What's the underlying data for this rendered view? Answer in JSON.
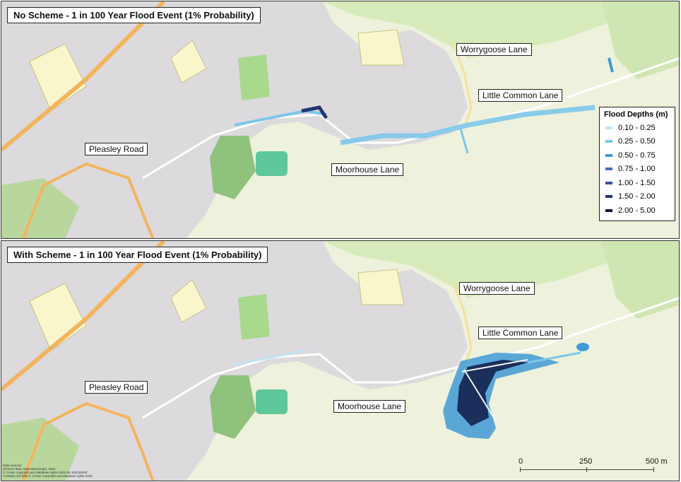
{
  "panels": [
    {
      "title": "No Scheme - 1 in 100 Year Flood Event (1% Probability)",
      "labels": {
        "worrygoose": "Worrygoose Lane",
        "little_common": "Little Common Lane",
        "pleasley": "Pleasley Road",
        "moorhouse": "Moorhouse Lane"
      }
    },
    {
      "title": "With Scheme - 1 in 100 Year Flood Event (1% Probability)",
      "labels": {
        "worrygoose": "Worrygoose Lane",
        "little_common": "Little Common Lane",
        "pleasley": "Pleasley Road",
        "moorhouse": "Moorhouse Lane"
      }
    }
  ],
  "legend": {
    "title": "Flood Depths (m)",
    "items": [
      {
        "label": "0.10 - 0.25",
        "color": "#bfe3f5"
      },
      {
        "label": "0.25 - 0.50",
        "color": "#7cc7ea"
      },
      {
        "label": "0.50 - 0.75",
        "color": "#3f9ad6"
      },
      {
        "label": "0.75 - 1.00",
        "color": "#4a6fb3"
      },
      {
        "label": "1.00 - 1.50",
        "color": "#3a4f9a"
      },
      {
        "label": "1.50 - 2.00",
        "color": "#263470"
      },
      {
        "label": "2.00 - 5.00",
        "color": "#0f1a45"
      }
    ]
  },
  "scale": {
    "ticks": [
      "0",
      "250",
      "500 m"
    ]
  },
  "credits": [
    "Data sources:",
    "Scheme data: Mott MacDonald, 2024.",
    "© Crown copyright and database rights 2022-05 100019320",
    "Contains OS data © Crown Copyright and database rights 2022"
  ],
  "colors": {
    "urban": "#dcdadd",
    "field": "#eef1dc",
    "woodland": "#cfe6b2",
    "park": "#9ccf8a",
    "school": "#faf6cc",
    "main_road": "#f2b45e",
    "road": "#ffffff"
  }
}
